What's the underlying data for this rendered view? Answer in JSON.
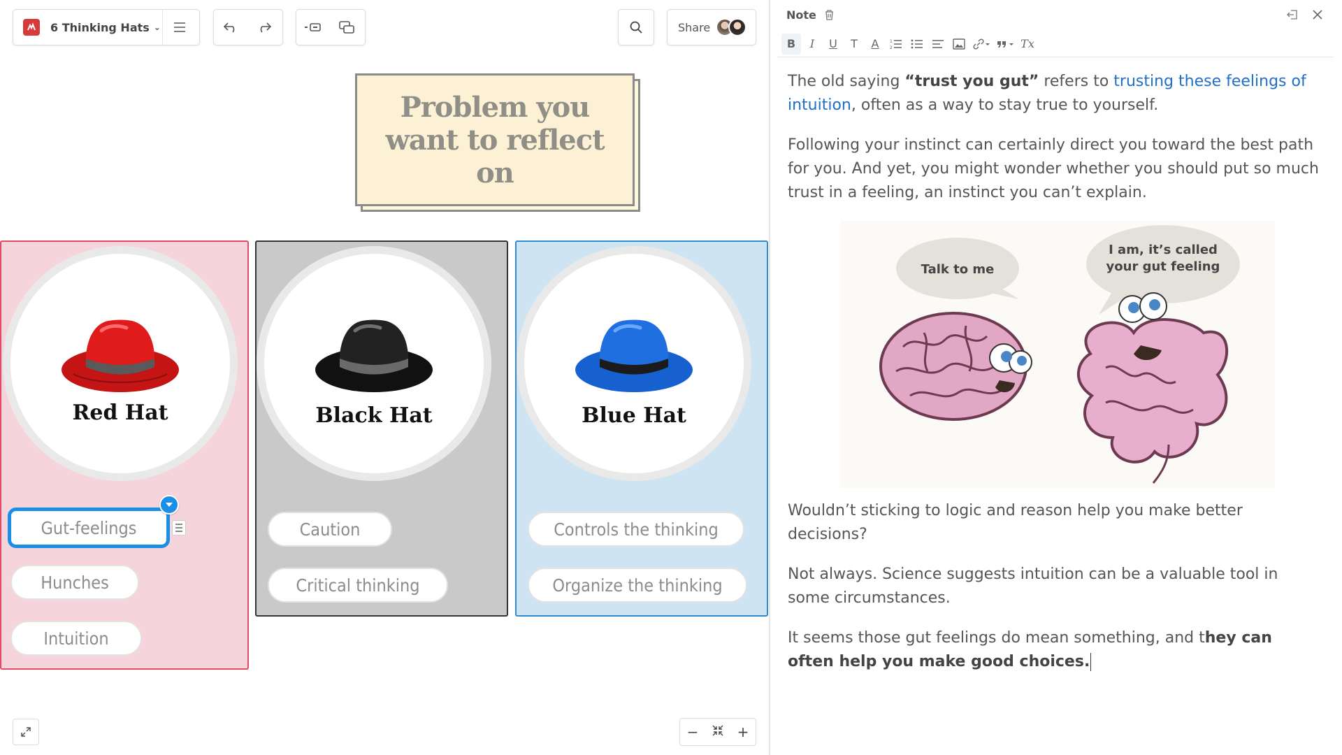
{
  "toolbar": {
    "doc_title": "6 Thinking Hats",
    "share_label": "Share"
  },
  "problem_note": {
    "text": "Problem you want to reflect on"
  },
  "hats": [
    {
      "name": "Red Hat",
      "color": "#e01b1b",
      "band": "#5a5a5a",
      "chips": [
        "Gut-feelings",
        "Hunches",
        "Intuition"
      ],
      "selected_chip": "Gut-feelings"
    },
    {
      "name": "Black Hat",
      "color": "#1c1c1c",
      "band": "#6a6a6a",
      "chips": [
        "Caution",
        "Critical thinking"
      ]
    },
    {
      "name": "Blue Hat",
      "color": "#1f6fe0",
      "band": "#1b1b1b",
      "chips": [
        "Controls the thinking",
        "Organize the thinking"
      ]
    }
  ],
  "note_panel": {
    "title": "Note",
    "formatting": [
      "B",
      "I",
      "U",
      "T",
      "A",
      "Tx"
    ],
    "p1": {
      "pre": "The old saying ",
      "bold": "“trust you gut”",
      "mid": " refers to ",
      "link": "trusting these feelings of intuition",
      "post": ", often as a way to stay true to yourself."
    },
    "p2": "Following your instinct can certainly direct you toward the best path for you. And yet, you might wonder whether you should put so much trust in a feeling, an instinct you can’t explain.",
    "image": {
      "bubble_left": "Talk to me",
      "bubble_right": "I am, it’s called your gut feeling"
    },
    "p3": "Wouldn’t sticking to logic and reason help you make better decisions?",
    "p4": "Not always. Science suggests intuition can be a valuable tool in some circumstances.",
    "p5": {
      "pre": "It seems those gut feelings do mean something, and t",
      "bold": "hey can often help you make good choices."
    }
  },
  "colors": {
    "red_column": "#f5d4db",
    "black_column": "#c9c9c9",
    "blue_column": "#cfe4f2",
    "selection": "#1a8fe8",
    "link": "#1f6fc7"
  }
}
